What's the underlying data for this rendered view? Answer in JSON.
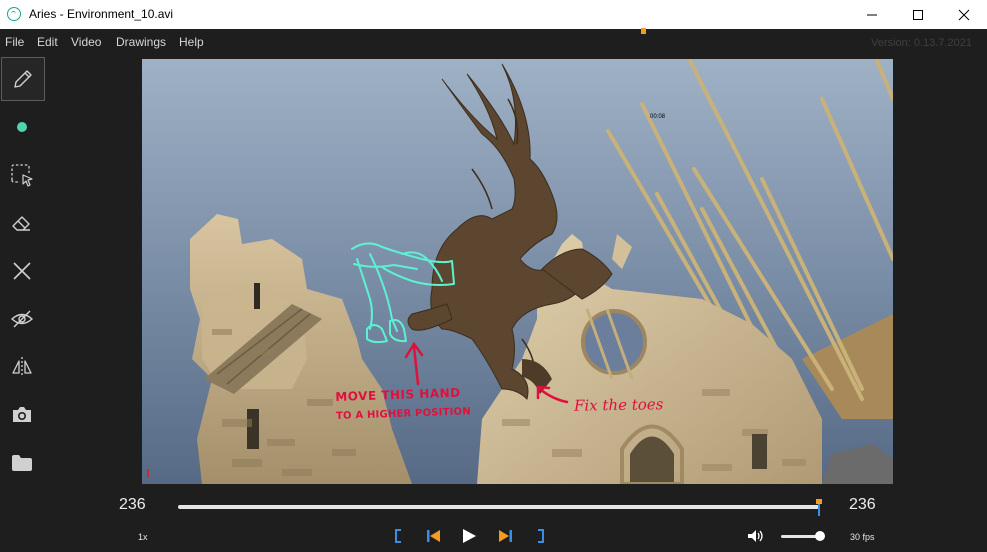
{
  "window": {
    "title": "Aries - Environment_10.avi",
    "controls": [
      "minimize",
      "maximize",
      "close"
    ]
  },
  "menu": {
    "items": [
      "File",
      "Edit",
      "Video",
      "Drawings",
      "Help"
    ],
    "version": "Version: 0.13.7.2021"
  },
  "tools": [
    {
      "name": "pencil-icon",
      "active": true
    },
    {
      "name": "color-dot-icon",
      "color": "#4fd6b0"
    },
    {
      "name": "lasso-select-icon"
    },
    {
      "name": "eraser-icon"
    },
    {
      "name": "clear-icon"
    },
    {
      "name": "visibility-icon"
    },
    {
      "name": "flip-icon"
    },
    {
      "name": "camera-icon"
    },
    {
      "name": "folder-icon"
    }
  ],
  "viewport": {
    "timestamp": "00:08",
    "annotations": {
      "note1_line1": "MOVE THIS HAND",
      "note1_line2": "TO A HIGHER POSITION",
      "note2": "Fix the toes",
      "ink_color": "#e0103d",
      "sketch_color": "#5ef0d2"
    }
  },
  "transport": {
    "current_frame": "236",
    "end_frame": "236",
    "progress": 1.0,
    "speed": "1x",
    "fps": "30 fps",
    "volume": 0.85,
    "accent": "#f39c1f",
    "bracket_color": "#3a8ee6"
  }
}
